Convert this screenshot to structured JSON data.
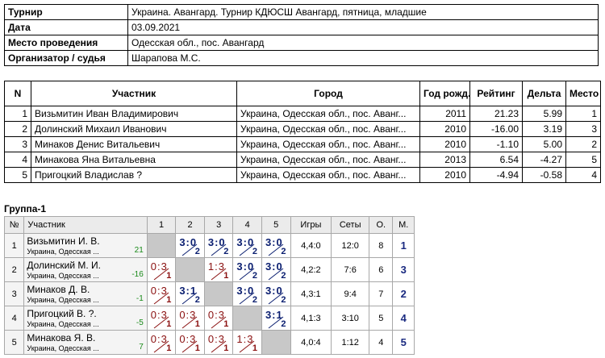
{
  "info": [
    {
      "label": "Турнир",
      "value": "Украина. Авангард. Турнир КДЮСШ Авангард, пятница, младшие"
    },
    {
      "label": "Дата",
      "value": "03.09.2021"
    },
    {
      "label": "Место проведения",
      "value": "Одесская обл., пос. Авангард"
    },
    {
      "label": "Организатор / судья",
      "value": "Шарапова М.С."
    }
  ],
  "participants": {
    "headers": [
      "N",
      "Участник",
      "Город",
      "Год рожд.",
      "Рейтинг",
      "Дельта",
      "Место"
    ],
    "rows": [
      [
        "1",
        "Визьмитин Иван Владимирович",
        "Украина, Одесская обл., пос. Аванг...",
        "2011",
        "21.23",
        "5.99",
        "1"
      ],
      [
        "2",
        "Долинский Михаил Иванович",
        "Украина, Одесская обл., пос. Аванг...",
        "2010",
        "-16.00",
        "3.19",
        "3"
      ],
      [
        "3",
        "Минаков Денис Витальевич",
        "Украина, Одесская обл., пос. Аванг...",
        "2010",
        "-1.10",
        "5.00",
        "2"
      ],
      [
        "4",
        "Минакова Яна Витальевна",
        "Украина, Одесская обл., пос. Аванг...",
        "2013",
        "6.54",
        "-4.27",
        "5"
      ],
      [
        "5",
        "Пригоцкий Владислав ?",
        "Украина, Одесская обл., пос. Аванг...",
        "2010",
        "-4.94",
        "-0.58",
        "4"
      ]
    ]
  },
  "group": {
    "title": "Группа-1",
    "headers": [
      "№",
      "Участник",
      "1",
      "2",
      "3",
      "4",
      "5",
      "Игры",
      "Сеты",
      "О.",
      "М."
    ],
    "rows": [
      {
        "n": "1",
        "name": "Визьмитин И. В.",
        "city": "Украина, Одесская ...",
        "rating": "21",
        "cells": [
          null,
          {
            "s": "3:0",
            "p": "2"
          },
          {
            "s": "3:0",
            "p": "2"
          },
          {
            "s": "3:0",
            "p": "2"
          },
          {
            "s": "3:0",
            "p": "2"
          }
        ],
        "games": "4,4:0",
        "sets": "12:0",
        "points": "8",
        "place": "1"
      },
      {
        "n": "2",
        "name": "Долинский М. И.",
        "city": "Украина, Одесская ...",
        "rating": "-16",
        "cells": [
          {
            "s": "0:3",
            "p": "1"
          },
          null,
          {
            "s": "1:3",
            "p": "1"
          },
          {
            "s": "3:0",
            "p": "2"
          },
          {
            "s": "3:0",
            "p": "2"
          }
        ],
        "games": "4,2:2",
        "sets": "7:6",
        "points": "6",
        "place": "3"
      },
      {
        "n": "3",
        "name": "Минаков Д. В.",
        "city": "Украина, Одесская ...",
        "rating": "-1",
        "cells": [
          {
            "s": "0:3",
            "p": "1"
          },
          {
            "s": "3:1",
            "p": "2"
          },
          null,
          {
            "s": "3:0",
            "p": "2"
          },
          {
            "s": "3:0",
            "p": "2"
          }
        ],
        "games": "4,3:1",
        "sets": "9:4",
        "points": "7",
        "place": "2"
      },
      {
        "n": "4",
        "name": "Пригоцкий В. ?.",
        "city": "Украина, Одесская ...",
        "rating": "-5",
        "cells": [
          {
            "s": "0:3",
            "p": "1"
          },
          {
            "s": "0:3",
            "p": "1"
          },
          {
            "s": "0:3",
            "p": "1"
          },
          null,
          {
            "s": "3:1",
            "p": "2"
          }
        ],
        "games": "4,1:3",
        "sets": "3:10",
        "points": "5",
        "place": "4"
      },
      {
        "n": "5",
        "name": "Минакова Я. В.",
        "city": "Украина, Одесская ...",
        "rating": "7",
        "cells": [
          {
            "s": "0:3",
            "p": "1"
          },
          {
            "s": "0:3",
            "p": "1"
          },
          {
            "s": "0:3",
            "p": "1"
          },
          {
            "s": "1:3",
            "p": "1"
          },
          null
        ],
        "games": "4,0:4",
        "sets": "1:12",
        "points": "4",
        "place": "5"
      }
    ]
  }
}
